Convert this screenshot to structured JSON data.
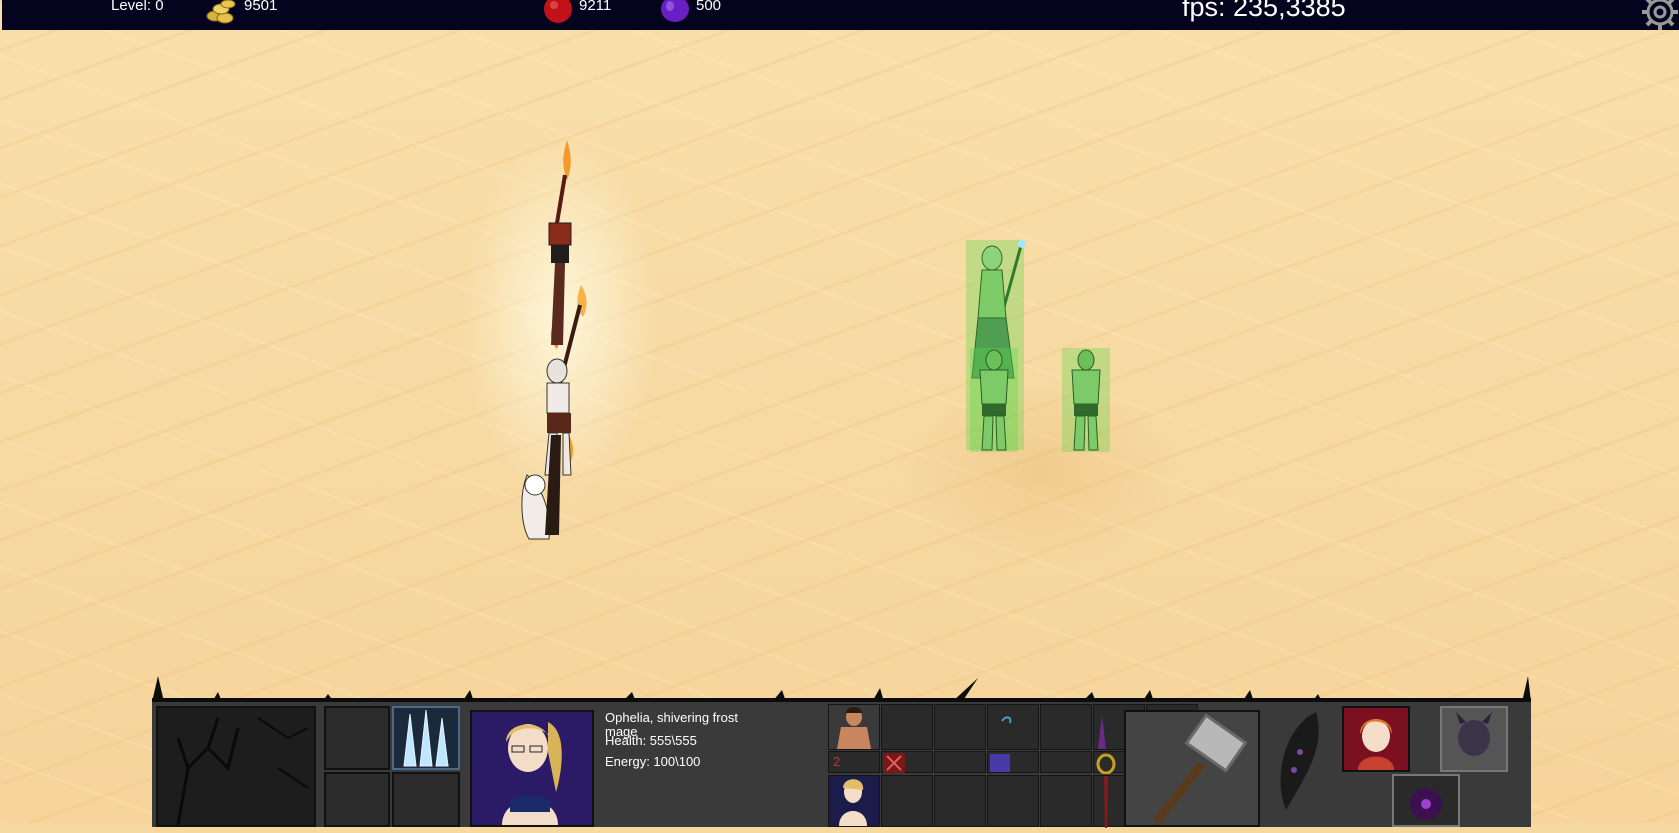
{
  "topbar": {
    "level_label": "Level: 0",
    "gold": "9501",
    "red_resource": "9211",
    "purple_resource": "500",
    "fps": "fps: 235,3385"
  },
  "icons": {
    "gold": "gold-coins-icon",
    "red": "red-gem-icon",
    "purple": "purple-gem-icon",
    "settings": "gear-icon"
  },
  "colors": {
    "topbar_bg": "#04041e",
    "sand": "#f6d49a",
    "hud_bg": "#3a3a3a",
    "ally_glow": "#5fd84a"
  },
  "selected_unit": {
    "name": "Ophelia, shivering frost mage",
    "health": "Health: 555\\555",
    "energy": "Energy: 100\\100"
  },
  "inventory": {
    "stack_count": "2"
  }
}
